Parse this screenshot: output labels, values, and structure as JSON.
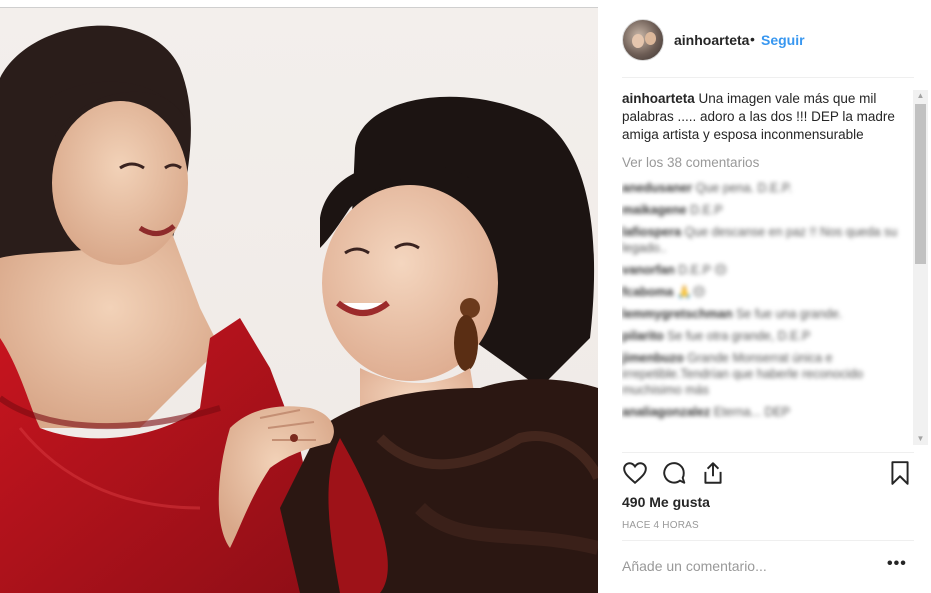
{
  "post": {
    "image_alt": "Photo of two women smiling at each other",
    "colors": {
      "dress_red": "#b3141c",
      "dress_dark": "#2b1712",
      "hair": "#1c1412",
      "skin": "#e9c3a5",
      "background": "#f1ece8"
    }
  },
  "header": {
    "username": "ainhoarteta",
    "separator": "•",
    "follow_label": "Seguir",
    "follow_color": "#3897f0"
  },
  "caption": {
    "username": "ainhoarteta",
    "text": " Una imagen vale más que mil palabras ..... adoro a las dos !!! DEP la madre amiga artista y esposa inconmensurable"
  },
  "view_all_comments": "Ver los 38 comentarios",
  "comments": [
    {
      "user": "anedusaner",
      "text": "Que pena. D.E.P."
    },
    {
      "user": "maikagene",
      "text": "D.E.P"
    },
    {
      "user": "lafiospera",
      "text": "Que descanse en paz !! Nos queda su legado.."
    },
    {
      "user": "vanorfan",
      "text": "D.E.P 😔"
    },
    {
      "user": "fcaboma",
      "text": "🙏😔"
    },
    {
      "user": "lemmygretschman",
      "text": "Se fue una grande."
    },
    {
      "user": "pilarito",
      "text": "Se fue otra grande, D.E.P"
    },
    {
      "user": "jimenbuzo",
      "text": "Grande Monserrat única e irrepetible.Tendrían que haberle reconocido muchisimo más"
    },
    {
      "user": "analiagonzalez",
      "text": "Eterna... DEP"
    }
  ],
  "actions": {
    "like_icon": "heart-icon",
    "comment_icon": "comment-icon",
    "share_icon": "share-icon",
    "save_icon": "bookmark-icon"
  },
  "likes_label": "490 Me gusta",
  "timestamp": "HACE 4 HORAS",
  "add_comment": {
    "placeholder": "Añade un comentario...",
    "value": ""
  },
  "more_label": "•••"
}
